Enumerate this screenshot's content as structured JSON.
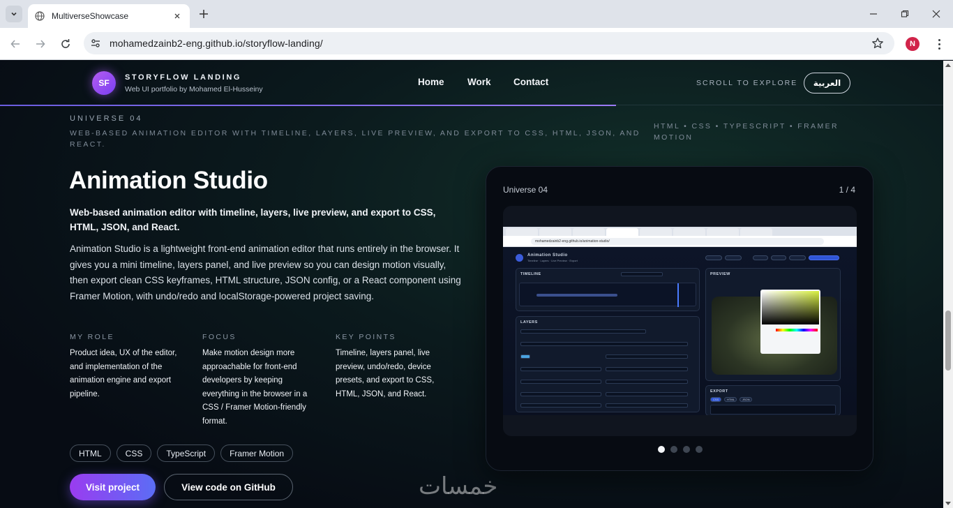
{
  "browser": {
    "tab_title": "MultiverseShowcase",
    "url": "mohamedzainb2-eng.github.io/storyflow-landing/",
    "profile_initial": "N"
  },
  "header": {
    "logo_initials": "SF",
    "brand_title": "STORYFLOW LANDING",
    "brand_subtitle": "Web UI portfolio by Mohamed El-Husseiny",
    "nav": [
      "Home",
      "Work",
      "Contact"
    ],
    "scroll_hint": "SCROLL TO EXPLORE",
    "lang_button": "العربية",
    "scroll_progress": 0.653
  },
  "project": {
    "universe": "UNIVERSE 04",
    "tagline_caps": "WEB-BASED ANIMATION EDITOR WITH TIMELINE, LAYERS, LIVE PREVIEW, AND EXPORT TO CSS, HTML, JSON, AND REACT.",
    "tech_caps": "HTML • CSS • TYPESCRIPT • FRAMER MOTION",
    "title": "Animation Studio",
    "subtitle": "Web-based animation editor with timeline, layers, live preview, and export to CSS, HTML, JSON, and React.",
    "description": "Animation Studio is a lightweight front-end animation editor that runs entirely in the browser. It gives you a mini timeline, layers panel, and live preview so you can design motion visually, then export clean CSS keyframes, HTML structure, JSON config, or a React component using Framer Motion, with undo/redo and localStorage-powered project saving.",
    "columns": [
      {
        "heading": "MY ROLE",
        "text": "Product idea, UX of the editor, and implementation of the animation engine and export pipeline."
      },
      {
        "heading": "FOCUS",
        "text": "Make motion design more approachable for front-end developers by keeping everything in the browser in a CSS / Framer Motion-friendly format."
      },
      {
        "heading": "KEY POINTS",
        "text": "Timeline, layers panel, live preview, undo/redo, device presets, and export to CSS, HTML, JSON, and React."
      }
    ],
    "tags": [
      "HTML",
      "CSS",
      "TypeScript",
      "Framer Motion"
    ],
    "primary_button": "Visit project",
    "secondary_button": "View code on GitHub"
  },
  "showcase": {
    "label": "Universe 04",
    "counter": "1 / 4",
    "slides": 4,
    "active_slide": 1,
    "mini": {
      "url": "mohamedzainb2-eng.github.io/animation-studio/",
      "app_title": "Animation Studio",
      "app_sub": "Timeline · Layers · Live Preview · Export",
      "timeline": "TIMELINE",
      "layers": "LAYERS",
      "preview": "PREVIEW",
      "export": "EXPORT",
      "export_tabs": [
        "CSS",
        "HTML",
        "JSON"
      ]
    }
  },
  "watermark": "خمسات"
}
